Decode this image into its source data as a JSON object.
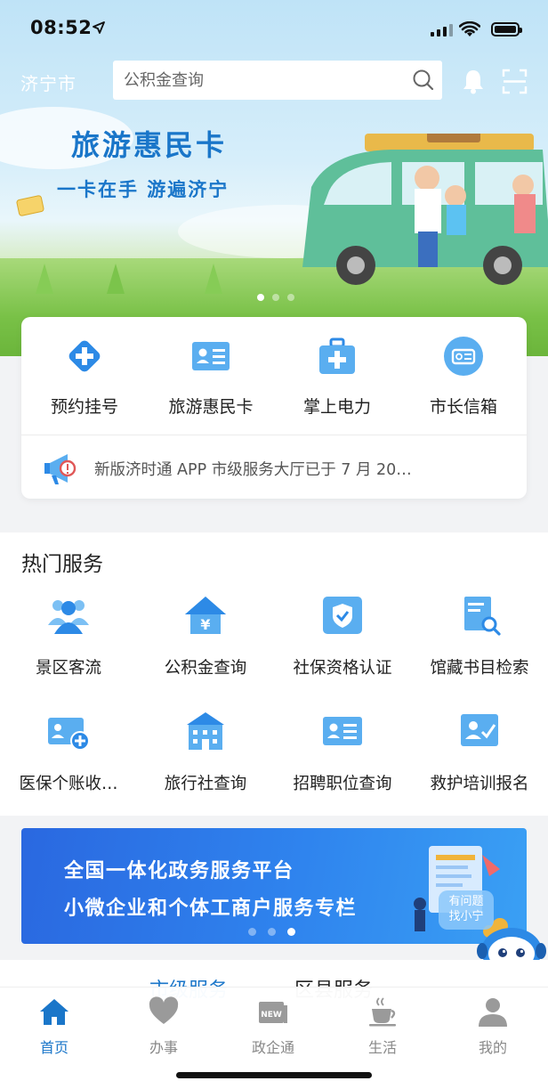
{
  "status_bar": {
    "time": "08:52"
  },
  "header": {
    "city": "济宁市",
    "search_placeholder": "公积金查询"
  },
  "banner": {
    "title": "旅游惠民卡",
    "subtitle": "一卡在手 游遍济宁",
    "page_index": 1,
    "page_count": 3
  },
  "quick_services": [
    {
      "label": "预约挂号",
      "icon": "hospital-plus-icon"
    },
    {
      "label": "旅游惠民卡",
      "icon": "id-card-icon"
    },
    {
      "label": "掌上电力",
      "icon": "medical-kit-icon"
    },
    {
      "label": "市长信箱",
      "icon": "mail-badge-icon"
    }
  ],
  "notice": {
    "text": "新版济时通 APP 市级服务大厅已于 7 月 20…"
  },
  "hot_services": {
    "title": "热门服务",
    "items": [
      {
        "label": "景区客流",
        "icon": "people-icon"
      },
      {
        "label": "公积金查询",
        "icon": "house-yen-icon"
      },
      {
        "label": "社保资格认证",
        "icon": "shield-check-icon"
      },
      {
        "label": "馆藏书目检索",
        "icon": "book-search-icon"
      },
      {
        "label": "医保个账收…",
        "icon": "card-plus-icon"
      },
      {
        "label": "旅行社查询",
        "icon": "building-icon"
      },
      {
        "label": "招聘职位查询",
        "icon": "id-card-icon"
      },
      {
        "label": "救护培训报名",
        "icon": "user-check-icon"
      }
    ]
  },
  "promo": {
    "line1": "全国一体化政务服务平台",
    "line2": "小微企业和个体工商户服务专栏",
    "page_index": 3,
    "page_count": 3
  },
  "assistant": {
    "bubble": "有问题\n找小宁"
  },
  "region_tabs": {
    "city": "市级服务",
    "county": "区县服务"
  },
  "tabbar": [
    {
      "label": "首页",
      "icon": "home-icon",
      "active": true
    },
    {
      "label": "办事",
      "icon": "heart-icon",
      "active": false
    },
    {
      "label": "政企通",
      "icon": "news-icon",
      "active": false
    },
    {
      "label": "生活",
      "icon": "coffee-cup-icon",
      "active": false
    },
    {
      "label": "我的",
      "icon": "person-icon",
      "active": false
    }
  ],
  "colors": {
    "accent": "#1a76c9",
    "icon_light": "#5aaef0",
    "icon_dark": "#2d8ae6"
  }
}
